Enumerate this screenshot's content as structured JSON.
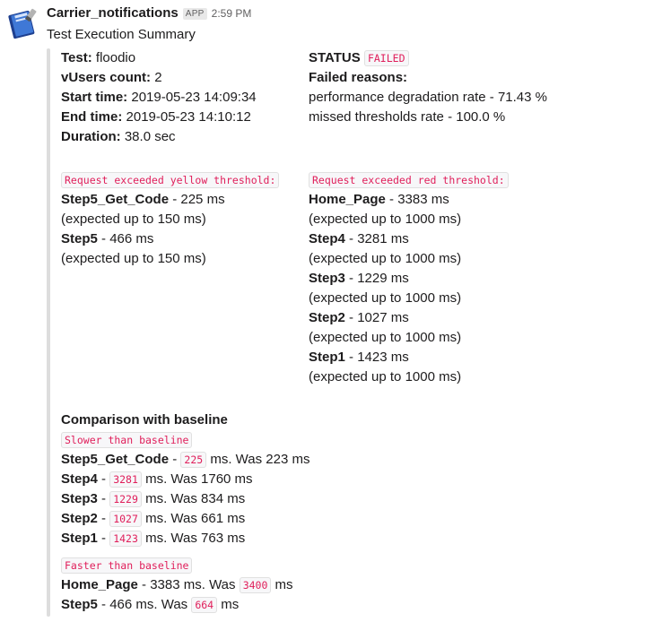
{
  "message": {
    "sender": "Carrier_notifications",
    "badge": "APP",
    "time": "2:59 PM",
    "title": "Test Execution Summary"
  },
  "info": {
    "test_label": "Test:",
    "test_value": " floodio",
    "vusers_label": "vUsers count:",
    "vusers_value": " 2",
    "start_label": "Start time:",
    "start_value": " 2019-05-23 14:09:34",
    "end_label": "End time:",
    "end_value": " 2019-05-23 14:10:12",
    "duration_label": "Duration:",
    "duration_value": " 38.0 sec"
  },
  "status": {
    "label": "STATUS",
    "value": "FAILED",
    "reasons_label": "Failed reasons:",
    "reasons": [
      "performance degradation rate - 71.43 %",
      "missed thresholds rate - 100.0 %"
    ]
  },
  "yellow": {
    "header": "Request exceeded yellow threshold:",
    "items": [
      {
        "name": "Step5_Get_Code",
        "value": " - 225 ms",
        "expected": "(expected up to 150 ms)"
      },
      {
        "name": "Step5",
        "value": " - 466 ms",
        "expected": "(expected up to 150 ms)"
      }
    ]
  },
  "red": {
    "header": "Request exceeded red threshold:",
    "items": [
      {
        "name": "Home_Page",
        "value": " - 3383 ms",
        "expected": "(expected up to 1000 ms)"
      },
      {
        "name": "Step4",
        "value": " - 3281 ms",
        "expected": "(expected up to 1000 ms)"
      },
      {
        "name": "Step3",
        "value": " - 1229 ms",
        "expected": "(expected up to 1000 ms)"
      },
      {
        "name": "Step2",
        "value": " - 1027 ms",
        "expected": "(expected up to 1000 ms)"
      },
      {
        "name": "Step1",
        "value": " - 1423 ms",
        "expected": "(expected up to 1000 ms)"
      }
    ]
  },
  "comparison": {
    "title": "Comparison with baseline",
    "slower_header": "Slower than baseline",
    "slower": [
      {
        "name": "Step5_Get_Code",
        "sep": " - ",
        "current": "225",
        "rest": " ms. Was 223 ms"
      },
      {
        "name": "Step4",
        "sep": " - ",
        "current": "3281",
        "rest": " ms. Was 1760 ms"
      },
      {
        "name": "Step3",
        "sep": " - ",
        "current": "1229",
        "rest": " ms. Was 834 ms"
      },
      {
        "name": "Step2",
        "sep": " - ",
        "current": "1027",
        "rest": " ms. Was 661 ms"
      },
      {
        "name": "Step1",
        "sep": " - ",
        "current": "1423",
        "rest": " ms. Was 763 ms"
      }
    ],
    "faster_header": "Faster than baseline",
    "faster": [
      {
        "name": "Home_Page",
        "text": " - 3383 ms. Was ",
        "baseline": "3400",
        "rest": " ms"
      },
      {
        "name": "Step5",
        "text": " - 466 ms. Was ",
        "baseline": "664",
        "rest": " ms"
      }
    ]
  }
}
